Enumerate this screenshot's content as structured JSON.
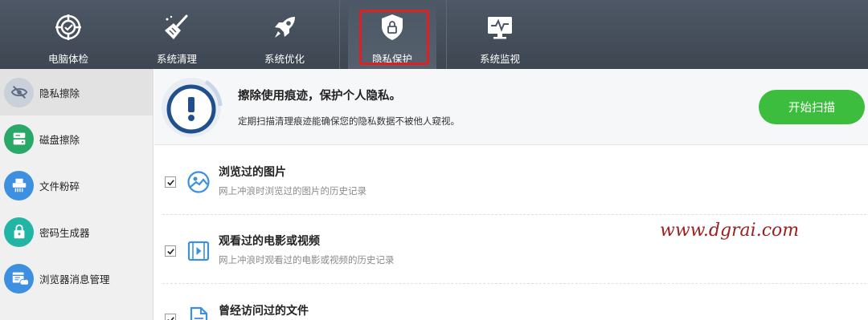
{
  "toolbar": {
    "tabs": [
      {
        "label": "电脑体检",
        "icon": "target-icon"
      },
      {
        "label": "系统清理",
        "icon": "broom-icon"
      },
      {
        "label": "系统优化",
        "icon": "rocket-icon"
      },
      {
        "label": "隐私保护",
        "icon": "shield-lock-icon",
        "active": true
      },
      {
        "label": "系统监视",
        "icon": "monitor-icon"
      }
    ]
  },
  "sidebar": {
    "items": [
      {
        "label": "隐私擦除",
        "icon": "eye-slash-icon",
        "color": "#5a6b82",
        "active": true
      },
      {
        "label": "磁盘擦除",
        "icon": "disk-icon",
        "color": "#2aa868"
      },
      {
        "label": "文件粉碎",
        "icon": "shredder-icon",
        "color": "#3d8fe0"
      },
      {
        "label": "密码生成器",
        "icon": "lock-icon",
        "color": "#22b5a6"
      },
      {
        "label": "浏览器消息管理",
        "icon": "browser-bell-icon",
        "color": "#3d8fe0"
      }
    ]
  },
  "hero": {
    "title": "擦除使用痕迹，保护个人隐私。",
    "subtitle": "定期扫描清理痕迹能确保您的隐私数据不被他人窥视。",
    "scan_button": "开始扫描"
  },
  "items": [
    {
      "title": "浏览过的图片",
      "desc": "网上冲浪时浏览过的图片的历史记录",
      "checked": true,
      "icon": "image-icon"
    },
    {
      "title": "观看过的电影或视频",
      "desc": "网上冲浪时观看过的电影或视频的历史记录",
      "checked": true,
      "icon": "video-icon"
    },
    {
      "title": "曾经访问过的文件",
      "desc": "",
      "checked": true,
      "icon": "document-icon"
    }
  ],
  "watermark": "www.dgrai.com",
  "colors": {
    "toolbar": "#454e5a",
    "accent_green": "#3dbd3d",
    "icon_blue": "#3d8fe0",
    "active_outline": "#e02020"
  }
}
